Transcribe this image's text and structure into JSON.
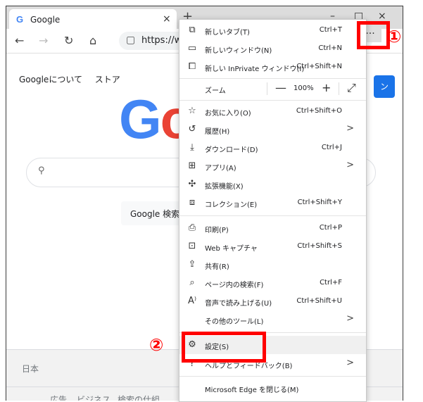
{
  "tab": {
    "favicon": "G",
    "title": "Google",
    "close": "×",
    "new_tab": "+"
  },
  "window_controls": {
    "minimize": "–",
    "maximize": "□",
    "close": "×"
  },
  "toolbar": {
    "back": "←",
    "forward": "→",
    "refresh": "↻",
    "home": "⌂",
    "lock": "🔒",
    "url": "https://w",
    "more": "···"
  },
  "page": {
    "top_links": [
      "Googleについて",
      "ストア"
    ],
    "logo_letters": [
      "G",
      "o"
    ],
    "search_icon": "⚲",
    "search_button": "Google 検索",
    "signin": "ン",
    "footer_country": "日本",
    "footer_links": [
      "広告",
      "ビジネス",
      "検索の仕組"
    ]
  },
  "menu": {
    "items": [
      {
        "icon": "⧉",
        "label": "新しいタブ(T)",
        "shortcut": "Ctrl+T"
      },
      {
        "icon": "▭",
        "label": "新しいウィンドウ(N)",
        "shortcut": "Ctrl+N"
      },
      {
        "icon": "⧠",
        "label": "新しい InPrivate ウィンドウ(I)",
        "shortcut": "Ctrl+Shift+N"
      }
    ],
    "zoom": {
      "label": "ズーム",
      "minus": "—",
      "value": "100%",
      "plus": "+",
      "fullscreen": "⤢"
    },
    "items2": [
      {
        "icon": "☆",
        "label": "お気に入り(O)",
        "shortcut": "Ctrl+Shift+O",
        "arrow": ""
      },
      {
        "icon": "↺",
        "label": "履歴(H)",
        "shortcut": "",
        "arrow": ">"
      },
      {
        "icon": "⤓",
        "label": "ダウンロード(D)",
        "shortcut": "Ctrl+J",
        "arrow": ""
      },
      {
        "icon": "⊞",
        "label": "アプリ(A)",
        "shortcut": "",
        "arrow": ">"
      },
      {
        "icon": "✣",
        "label": "拡張機能(X)",
        "shortcut": "",
        "arrow": ""
      },
      {
        "icon": "⧈",
        "label": "コレクション(E)",
        "shortcut": "Ctrl+Shift+Y",
        "arrow": ""
      }
    ],
    "items3": [
      {
        "icon": "⎙",
        "label": "印刷(P)",
        "shortcut": "Ctrl+P",
        "arrow": ""
      },
      {
        "icon": "⊡",
        "label": "Web キャプチャ",
        "shortcut": "Ctrl+Shift+S",
        "arrow": ""
      },
      {
        "icon": "⇪",
        "label": "共有(R)",
        "shortcut": "",
        "arrow": ""
      },
      {
        "icon": "⌕",
        "label": "ページ内の検索(F)",
        "shortcut": "Ctrl+F",
        "arrow": ""
      },
      {
        "icon": "A⁾",
        "label": "音声で読み上げる(U)",
        "shortcut": "Ctrl+Shift+U",
        "arrow": ""
      },
      {
        "icon": "",
        "label": "その他のツール(L)",
        "shortcut": "",
        "arrow": ">"
      }
    ],
    "settings": {
      "icon": "⚙",
      "label": "設定(S)"
    },
    "help": {
      "icon": "?",
      "label": "ヘルプとフィードバック(B)",
      "arrow": ">"
    },
    "close_edge": "Microsoft Edge を閉じる(M)"
  },
  "callouts": {
    "one": "①",
    "two": "②",
    "color": "#ff0000"
  }
}
